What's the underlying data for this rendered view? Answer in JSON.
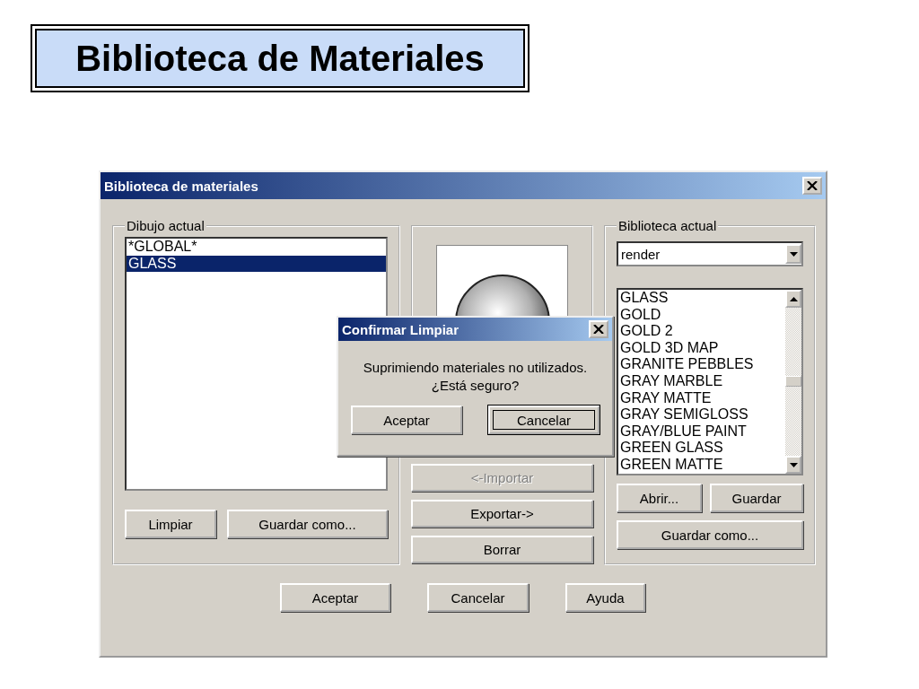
{
  "slide_title": "Biblioteca de Materiales",
  "window": {
    "title": "Biblioteca de materiales"
  },
  "current_drawing": {
    "label": "Dibujo actual",
    "items": [
      {
        "label": "*GLOBAL*",
        "selected": false
      },
      {
        "label": "GLASS",
        "selected": true
      }
    ],
    "buttons": [
      {
        "label": "Limpiar"
      },
      {
        "label": "Guardar como..."
      }
    ]
  },
  "preview": {
    "buttons": [
      {
        "label": "<-Importar",
        "disabled": true
      },
      {
        "label": "Exportar->",
        "disabled": false
      },
      {
        "label": "Borrar",
        "disabled": false
      }
    ]
  },
  "current_library": {
    "label": "Biblioteca actual",
    "dropdown": "render",
    "items": [
      "GLASS",
      "GOLD",
      "GOLD 2",
      "GOLD 3D MAP",
      "GRANITE PEBBLES",
      "GRAY MARBLE",
      "GRAY MATTE",
      "GRAY SEMIGLOSS",
      "GRAY/BLUE PAINT",
      "GREEN GLASS",
      "GREEN MATTE"
    ],
    "buttons": [
      {
        "label": "Abrir..."
      },
      {
        "label": "Guardar"
      },
      {
        "label": "Guardar como..."
      }
    ]
  },
  "dialog_buttons": [
    {
      "label": "Aceptar"
    },
    {
      "label": "Cancelar"
    },
    {
      "label": "Ayuda"
    }
  ],
  "confirm": {
    "title": "Confirmar Limpiar",
    "message": "Suprimiendo materiales no utilizados.\n¿Está seguro?",
    "buttons": [
      {
        "label": "Aceptar",
        "focused": false
      },
      {
        "label": "Cancelar",
        "focused": true
      }
    ]
  }
}
